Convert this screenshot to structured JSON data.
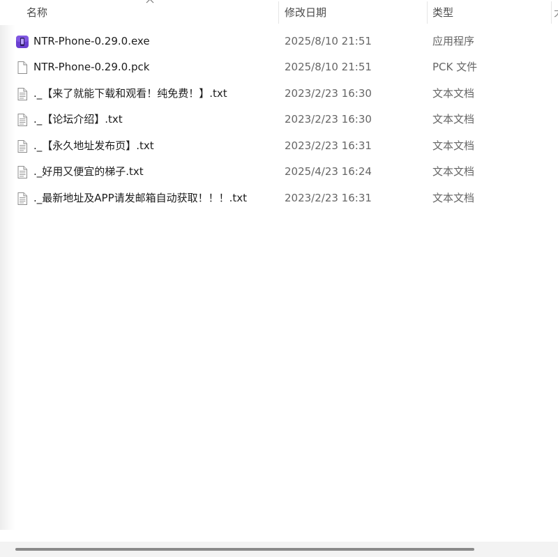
{
  "columns": {
    "name": "名称",
    "date": "修改日期",
    "type": "类型",
    "extra": "大"
  },
  "files": [
    {
      "name": "NTR-Phone-0.29.0.exe",
      "date": "2025/8/10 21:51",
      "type": "应用程序",
      "icon": "app-icon"
    },
    {
      "name": "NTR-Phone-0.29.0.pck",
      "date": "2025/8/10 21:51",
      "type": "PCK 文件",
      "icon": "blank-file-icon"
    },
    {
      "name": "._【来了就能下载和观看！纯免费！】.txt",
      "date": "2023/2/23 16:30",
      "type": "文本文档",
      "icon": "text-file-icon"
    },
    {
      "name": "._【论坛介绍】.txt",
      "date": "2023/2/23 16:30",
      "type": "文本文档",
      "icon": "text-file-icon"
    },
    {
      "name": "._【永久地址发布页】.txt",
      "date": "2023/2/23 16:31",
      "type": "文本文档",
      "icon": "text-file-icon"
    },
    {
      "name": "._好用又便宜的梯子.txt",
      "date": "2025/4/23 16:24",
      "type": "文本文档",
      "icon": "text-file-icon"
    },
    {
      "name": "._最新地址及APP请发邮箱自动获取！！！.txt",
      "date": "2023/2/23 16:31",
      "type": "文本文档",
      "icon": "text-file-icon"
    }
  ],
  "colors": {
    "app_icon": "#6a3fd1",
    "scroll_thumb": "#8a8a8a"
  }
}
